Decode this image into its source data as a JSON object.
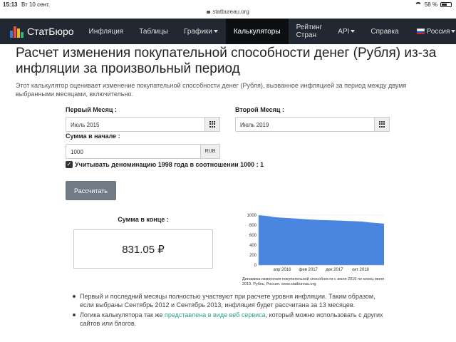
{
  "status_bar": {
    "time": "15:13",
    "date": "Вт 10 сент.",
    "url": "statbureau.org",
    "battery": "58 %",
    "battery_level": 0.58
  },
  "navbar": {
    "brand": "СтатБюро",
    "items": [
      {
        "label": "Инфляция"
      },
      {
        "label": "Таблицы"
      },
      {
        "label": "Графики",
        "dropdown": true
      },
      {
        "label": "Калькуляторы",
        "active": true
      },
      {
        "label": "Рейтинг Стран"
      },
      {
        "label": "API",
        "dropdown": true
      },
      {
        "label": "Справка"
      }
    ],
    "language": "Россия"
  },
  "page": {
    "title": "Расчет изменения покупательной способности денег (Рубля) из-за инфляции за произвольный период",
    "description": "Этот калькулятор оценивает изменение покупательной способности денег (Рубля), вызванное инфляцией за период между двумя выбранными месяцами, включительно."
  },
  "form": {
    "first_month_label": "Первый Месяц :",
    "first_month_value": "Июль 2015",
    "second_month_label": "Второй Месяц :",
    "second_month_value": "Июль 2019",
    "amount_label": "Сумма в начале :",
    "amount_value": "1000",
    "currency": "RUB",
    "denomination_label": "Учитывать деноминацию 1998 года в соотношении 1000 : 1",
    "denomination_checked": true,
    "submit_label": "Рассчитать"
  },
  "result": {
    "label": "Сумма в конце :",
    "value": "831.05 ₽"
  },
  "chart_data": {
    "type": "area",
    "title": "",
    "x": [
      "2015-07",
      "2015-09",
      "2015-11",
      "2016-01",
      "2016-03",
      "2016-05",
      "2016-07",
      "2016-09",
      "2016-11",
      "2017-01",
      "2017-03",
      "2017-05",
      "2017-07",
      "2017-09",
      "2017-11",
      "2018-01",
      "2018-03",
      "2018-05",
      "2018-07",
      "2018-09",
      "2018-11",
      "2019-01",
      "2019-03",
      "2019-05",
      "2019-07"
    ],
    "values": [
      1000,
      990,
      978,
      963,
      952,
      946,
      940,
      934,
      926,
      918,
      913,
      907,
      902,
      900,
      896,
      892,
      889,
      884,
      880,
      877,
      870,
      858,
      848,
      840,
      831
    ],
    "x_tick_labels": [
      "апр 2016",
      "фев 2017",
      "дек 2017",
      "окт 2018"
    ],
    "y_tick_labels": [
      "1000",
      "800",
      "600",
      "400",
      "200",
      "0"
    ],
    "ylim": [
      0,
      1000
    ],
    "color": "#4a86e0",
    "caption": "Динамика изменения покупательной способности с июля 2015 по конец июля 2019. Рубль, Россия. www.statbureau.org"
  },
  "notes": {
    "item1": "Первый и последний месяцы полностью участвуют при расчете уровня инфляции. Таким образом, если выбраны Сентябрь 2012 и Сентябрь 2013, инфляция будет рассчитана за 13 месяцев.",
    "item2_prefix": "Логика калькулятора так же ",
    "item2_link": "представлена в виде веб сервиса",
    "item2_suffix": ", который можно использовать с других сайтов или блогов."
  }
}
